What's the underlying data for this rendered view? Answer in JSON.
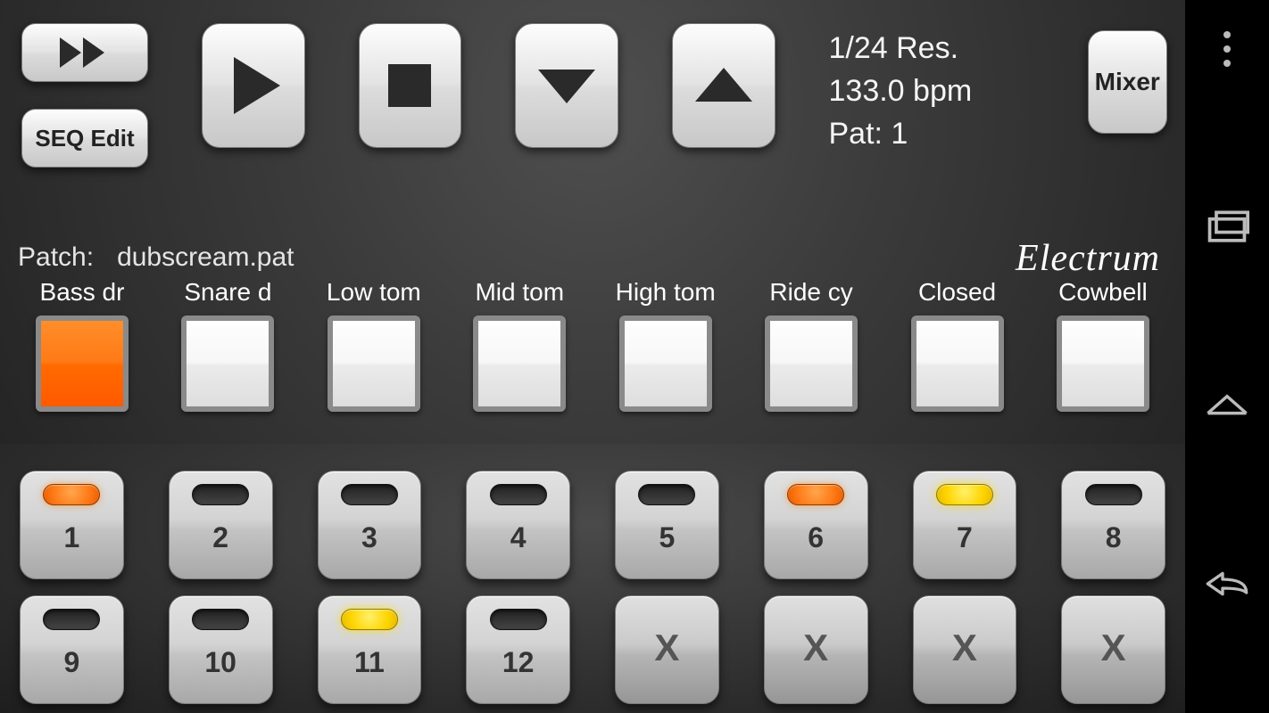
{
  "transport": {
    "ff_label": "",
    "seq_edit_label": "SEQ Edit",
    "mixer_label": "Mixer"
  },
  "info": {
    "resolution": "1/24 Res.",
    "bpm": "133.0 bpm",
    "pattern": "Pat: 1"
  },
  "patch": {
    "label": "Patch:",
    "name": "dubscream.pat"
  },
  "brand": "Electrum",
  "instruments": [
    {
      "label": "Bass dr",
      "active": true
    },
    {
      "label": "Snare d",
      "active": false
    },
    {
      "label": "Low tom",
      "active": false
    },
    {
      "label": "Mid tom",
      "active": false
    },
    {
      "label": "High tom",
      "active": false
    },
    {
      "label": "Ride cy",
      "active": false
    },
    {
      "label": "Closed",
      "active": false
    },
    {
      "label": "Cowbell",
      "active": false
    }
  ],
  "steps": [
    {
      "num": "1",
      "led": "orange",
      "disabled": false
    },
    {
      "num": "2",
      "led": "off",
      "disabled": false
    },
    {
      "num": "3",
      "led": "off",
      "disabled": false
    },
    {
      "num": "4",
      "led": "off",
      "disabled": false
    },
    {
      "num": "5",
      "led": "off",
      "disabled": false
    },
    {
      "num": "6",
      "led": "orange",
      "disabled": false
    },
    {
      "num": "7",
      "led": "yellow",
      "disabled": false
    },
    {
      "num": "8",
      "led": "off",
      "disabled": false
    },
    {
      "num": "9",
      "led": "off",
      "disabled": false
    },
    {
      "num": "10",
      "led": "off",
      "disabled": false
    },
    {
      "num": "11",
      "led": "yellow",
      "disabled": false
    },
    {
      "num": "12",
      "led": "off",
      "disabled": false
    },
    {
      "num": "X",
      "led": "none",
      "disabled": true
    },
    {
      "num": "X",
      "led": "none",
      "disabled": true
    },
    {
      "num": "X",
      "led": "none",
      "disabled": true
    },
    {
      "num": "X",
      "led": "none",
      "disabled": true
    }
  ]
}
